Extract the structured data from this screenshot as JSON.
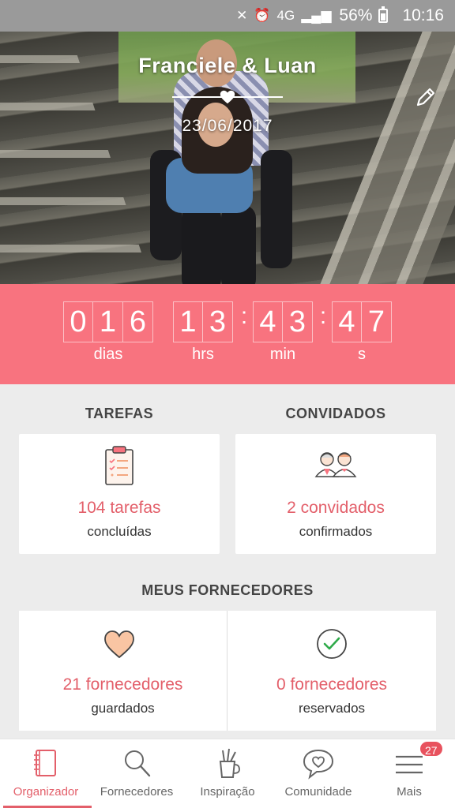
{
  "status_bar": {
    "network": "4G",
    "battery_percent": "56%",
    "time": "10:16"
  },
  "hero": {
    "title": "Franciele & Luan",
    "date": "23/06/2017"
  },
  "countdown": {
    "days": [
      "0",
      "1",
      "6"
    ],
    "hours": [
      "1",
      "3"
    ],
    "minutes": [
      "4",
      "3"
    ],
    "seconds": [
      "4",
      "7"
    ],
    "separator": ":",
    "labels": {
      "days": "dias",
      "hours": "hrs",
      "minutes": "min",
      "seconds": "s"
    }
  },
  "tasks": {
    "title": "TAREFAS",
    "count": "104 tarefas",
    "sub": "concluídas"
  },
  "guests": {
    "title": "CONVIDADOS",
    "count": "2 convidados",
    "sub": "confirmados"
  },
  "vendors": {
    "title": "MEUS FORNECEDORES",
    "saved": {
      "count": "21 fornecedores",
      "sub": "guardados"
    },
    "booked": {
      "count": "0 fornecedores",
      "sub": "reservados"
    }
  },
  "nav": {
    "items": [
      {
        "label": "Organizador",
        "icon": "notebook-icon",
        "active": true
      },
      {
        "label": "Fornecedores",
        "icon": "search-icon"
      },
      {
        "label": "Inspiração",
        "icon": "pencil-cup-icon"
      },
      {
        "label": "Comunidade",
        "icon": "chat-heart-icon"
      },
      {
        "label": "Mais",
        "icon": "menu-icon"
      }
    ],
    "badge": "27"
  },
  "colors": {
    "accent": "#f8737f",
    "accent_text": "#e35f6a",
    "background": "#ececec"
  }
}
